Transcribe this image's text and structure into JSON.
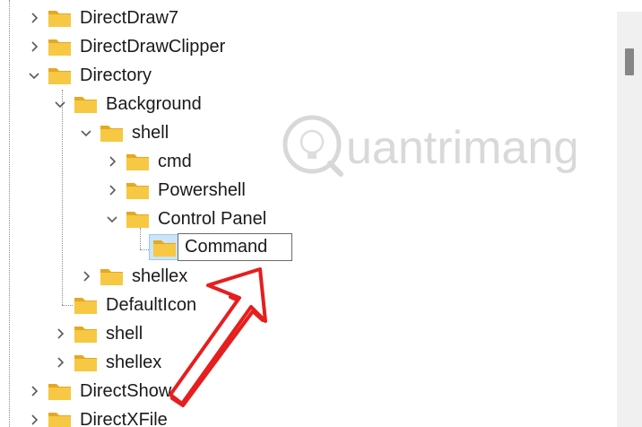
{
  "tree": {
    "items": [
      {
        "label": "DirectDraw7",
        "state": "collapsed"
      },
      {
        "label": "DirectDrawClipper",
        "state": "collapsed"
      },
      {
        "label": "Directory",
        "state": "expanded"
      },
      {
        "label": "Background",
        "state": "expanded"
      },
      {
        "label": "shell",
        "state": "expanded"
      },
      {
        "label": "cmd",
        "state": "collapsed"
      },
      {
        "label": "Powershell",
        "state": "collapsed"
      },
      {
        "label": "Control Panel",
        "state": "expanded"
      },
      {
        "label": "Command",
        "state": "editing"
      },
      {
        "label": "shellex",
        "state": "collapsed"
      },
      {
        "label": "DefaultIcon",
        "state": "leaf"
      },
      {
        "label": "shell",
        "state": "collapsed"
      },
      {
        "label": "shellex",
        "state": "collapsed"
      },
      {
        "label": "DirectShow",
        "state": "collapsed"
      },
      {
        "label": "DirectXFile",
        "state": "collapsed"
      }
    ]
  },
  "watermark": {
    "text": "uantrimang"
  },
  "colors": {
    "folder": "#f7c843",
    "folder_dark": "#e5a823",
    "arrow": "#e61e1e",
    "selection": "#cce4f7",
    "scrollbar_track": "#f0f0f0",
    "scrollbar_thumb": "#868686"
  },
  "icons": {
    "collapsed": "chevron-right-icon",
    "expanded": "chevron-down-icon",
    "node": "folder-icon",
    "annotation": "red-arrow-icon"
  }
}
